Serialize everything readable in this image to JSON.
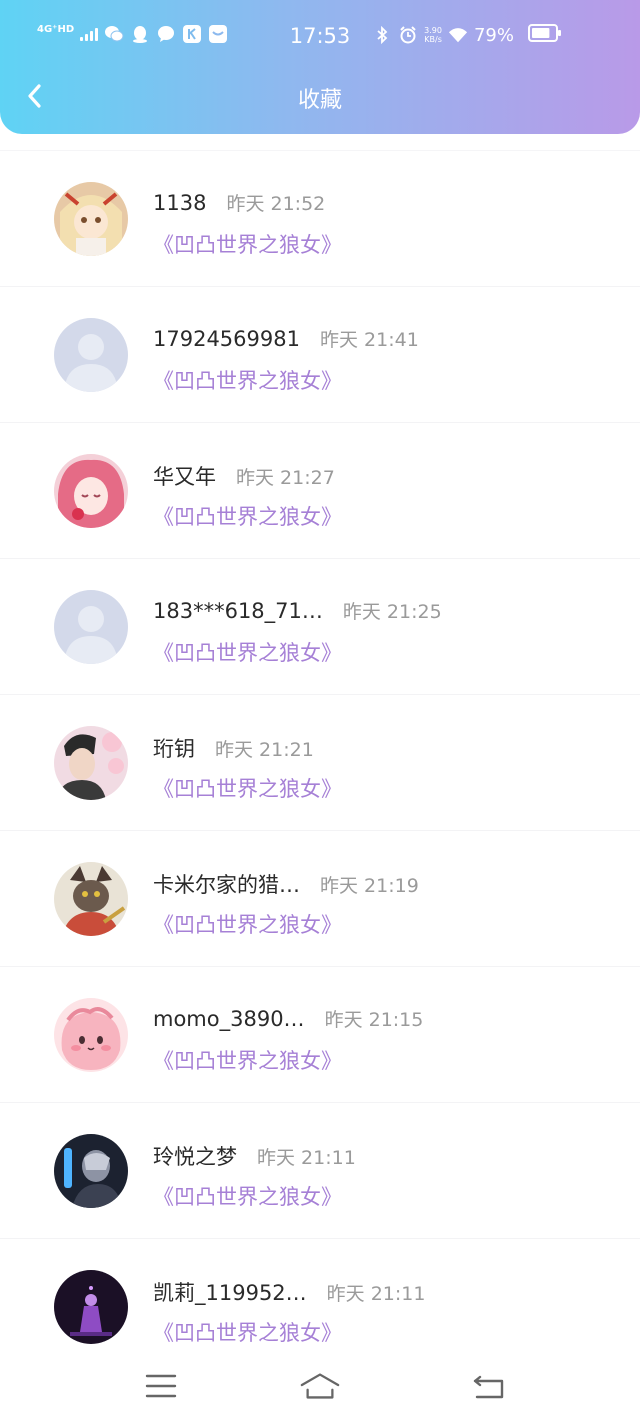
{
  "status_bar": {
    "network": "4G⁺HD",
    "time": "17:53",
    "speed_value": "3.90",
    "speed_unit": "KB/s",
    "battery": "79%",
    "battery_level": 0.79
  },
  "nav": {
    "title": "收藏"
  },
  "favorites": [
    {
      "user": "1138",
      "time": "昨天 21:52",
      "work": "《凹凸世界之狼女》",
      "avatar": "anime-blonde-girl"
    },
    {
      "user": "17924569981",
      "time": "昨天 21:41",
      "work": "《凹凸世界之狼女》",
      "avatar": "default-silhouette"
    },
    {
      "user": "华又年",
      "time": "昨天 21:27",
      "work": "《凹凸世界之狼女》",
      "avatar": "anime-pink-hair-girl"
    },
    {
      "user": "183***618_71…",
      "time": "昨天 21:25",
      "work": "《凹凸世界之狼女》",
      "avatar": "default-silhouette"
    },
    {
      "user": "珩钥",
      "time": "昨天 21:21",
      "work": "《凹凸世界之狼女》",
      "avatar": "man-cherry-blossom"
    },
    {
      "user": "卡米尔家的猎…",
      "time": "昨天 21:19",
      "work": "《凹凸世界之狼女》",
      "avatar": "anime-beast-character"
    },
    {
      "user": "momo_3890…",
      "time": "昨天 21:15",
      "work": "《凹凸世界之狼女》",
      "avatar": "pink-blob-mascot"
    },
    {
      "user": "玲悦之梦",
      "time": "昨天 21:11",
      "work": "《凹凸世界之狼女》",
      "avatar": "dark-armored-character"
    },
    {
      "user": "凯莉_119952…",
      "time": "昨天 21:11",
      "work": "《凹凸世界之狼女》",
      "avatar": "dark-purple-scene"
    }
  ],
  "bottom_nav": {
    "icons": [
      "menu-icon",
      "home-icon",
      "back-icon"
    ]
  },
  "colors": {
    "header_start": "#5fd3f4",
    "header_end": "#b99ae8",
    "accent": "#a680d6",
    "time_gray": "#9a9a9a"
  }
}
